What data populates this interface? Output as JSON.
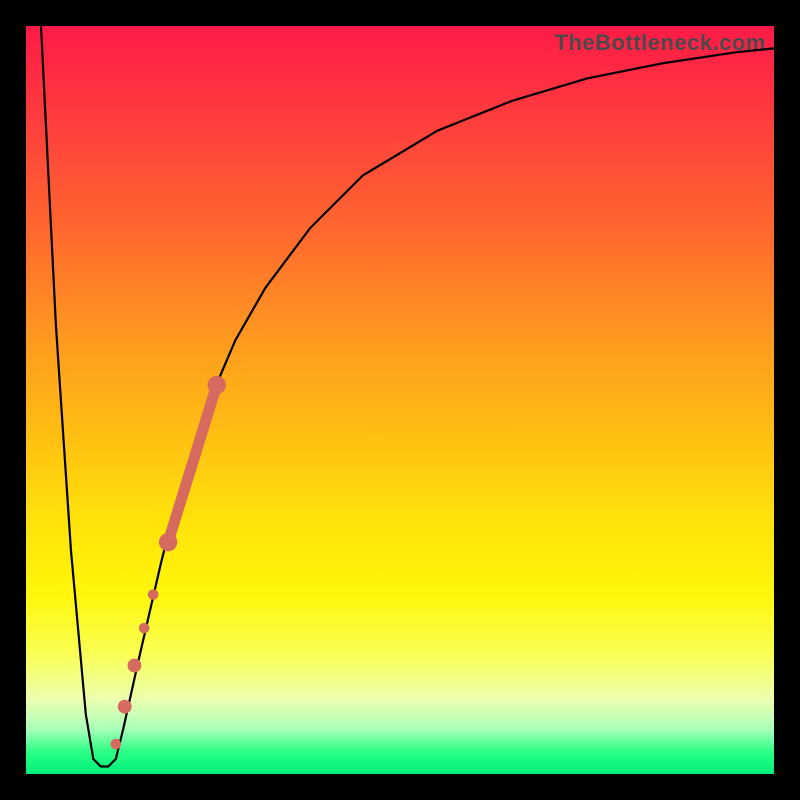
{
  "watermark": "TheBottleneck.com",
  "colors": {
    "frame": "#000000",
    "curve": "#000000",
    "marker": "#d66a5e",
    "gradient_top": "#ff1a47",
    "gradient_bottom": "#00f07a"
  },
  "chart_data": {
    "type": "line",
    "title": "",
    "xlabel": "",
    "ylabel": "",
    "xlim": [
      0,
      100
    ],
    "ylim": [
      0,
      100
    ],
    "grid": false,
    "series": [
      {
        "name": "bottleneck_curve",
        "x": [
          2,
          4,
          6,
          8,
          9,
          10,
          11,
          12,
          13,
          15,
          18,
          20,
          23,
          25,
          28,
          32,
          38,
          45,
          55,
          65,
          75,
          85,
          95,
          100
        ],
        "y": [
          100,
          60,
          30,
          8,
          2,
          1,
          1,
          2,
          6,
          15,
          28,
          36,
          45,
          51,
          58,
          65,
          73,
          80,
          86,
          90,
          93,
          95,
          96.5,
          97
        ]
      }
    ],
    "markers": [
      {
        "name": "band_top",
        "x": 25.5,
        "y": 52,
        "size": 4
      },
      {
        "name": "band_bottom",
        "x": 19.0,
        "y": 31,
        "size": 4
      },
      {
        "name": "dot_a",
        "x": 17.0,
        "y": 24,
        "size": 2.3
      },
      {
        "name": "dot_b",
        "x": 15.8,
        "y": 19.5,
        "size": 2.3
      },
      {
        "name": "dot_c",
        "x": 14.5,
        "y": 14.5,
        "size": 3
      },
      {
        "name": "dot_d",
        "x": 13.2,
        "y": 9,
        "size": 3
      },
      {
        "name": "dot_e",
        "x": 12.0,
        "y": 4,
        "size": 2.3
      }
    ]
  }
}
